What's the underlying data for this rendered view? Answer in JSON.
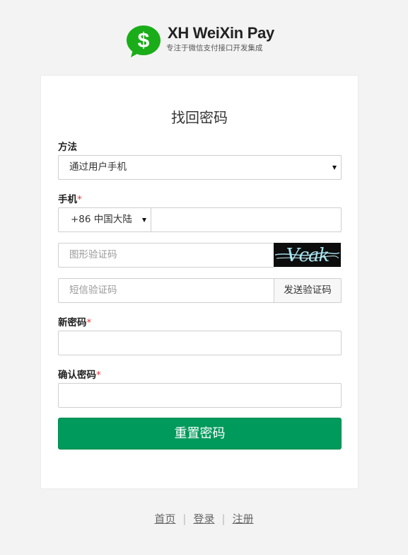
{
  "brand": {
    "logo_icon": "dollar-sign-chat-bubble-icon",
    "logo_color": "#1aad19",
    "title": "XH WeiXin Pay",
    "subtitle": "专注于微信支付接口开发集成"
  },
  "form": {
    "title": "找回密码",
    "method": {
      "label": "方法",
      "selected": "通过用户手机"
    },
    "phone": {
      "label": "手机",
      "required_mark": "*",
      "country_code": "+86 中国大陆",
      "value": ""
    },
    "captcha": {
      "placeholder": "图形验证码",
      "image_text": "Vcak"
    },
    "sms_code": {
      "placeholder": "短信验证码",
      "send_label": "发送验证码"
    },
    "new_password": {
      "label": "新密码",
      "required_mark": "*"
    },
    "confirm_password": {
      "label": "确认密码",
      "required_mark": "*"
    },
    "submit_label": "重置密码",
    "submit_color": "#009a5c"
  },
  "footer": {
    "links": [
      "首页",
      "登录",
      "注册"
    ],
    "separator": "|"
  }
}
